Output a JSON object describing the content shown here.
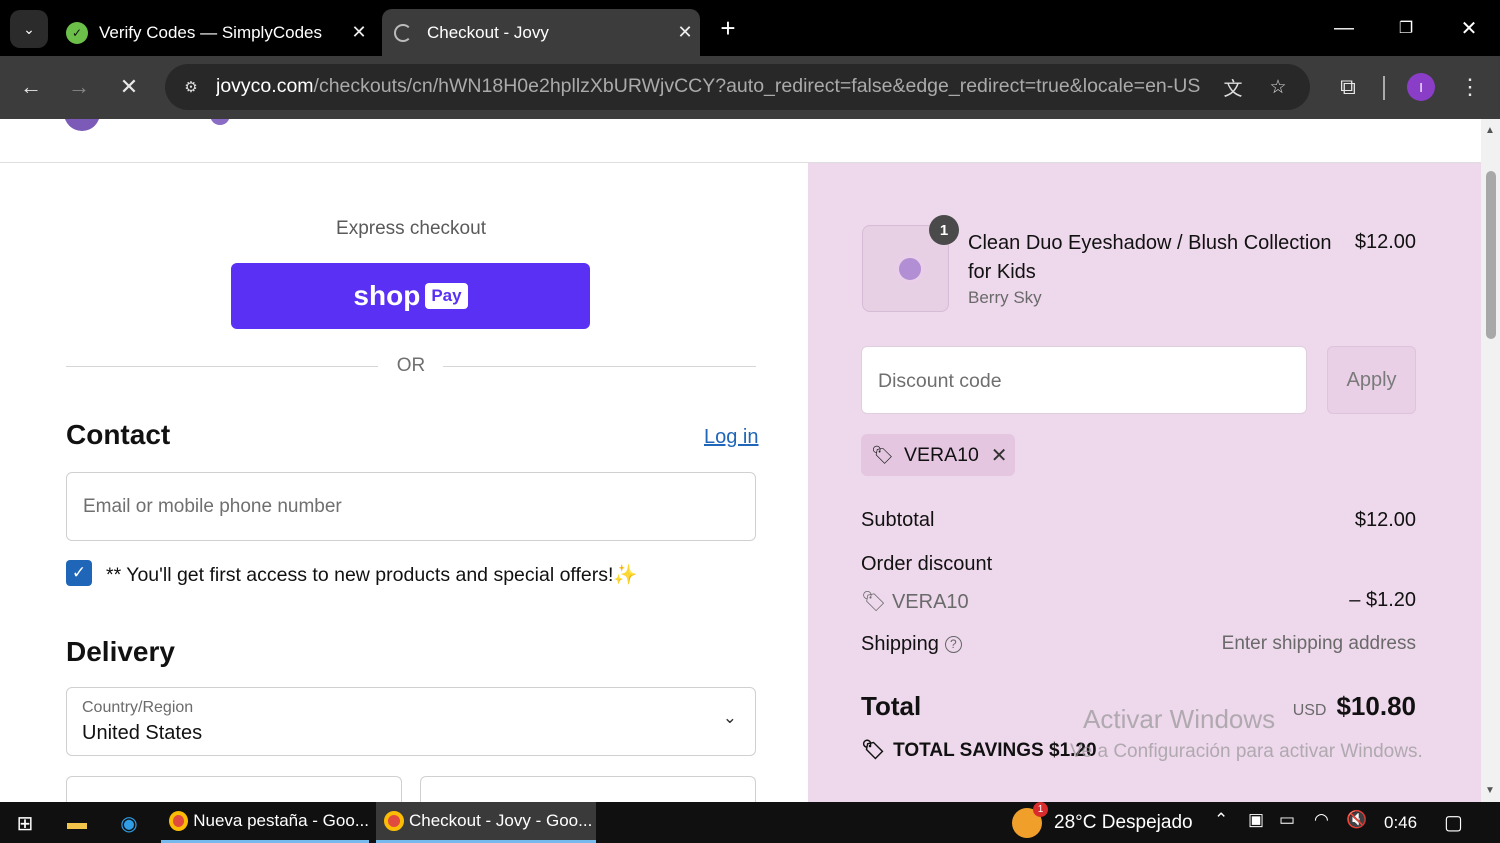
{
  "browser": {
    "tabs": [
      {
        "title": "Verify Codes — SimplyCodes",
        "icon": "simplycodes-icon",
        "active": false
      },
      {
        "title": "Checkout - Jovy",
        "icon": "loading-icon",
        "active": true
      }
    ],
    "url_host": "jovyco.com",
    "url_path": "/checkouts/cn/hWN18H0e2hpllzXbURWjvCCY?auto_redirect=false&edge_redirect=true&locale=en-US...",
    "profile_initial": "I"
  },
  "checkout": {
    "express_label": "Express checkout",
    "shoppay_label": "shop",
    "shoppay_badge": "Pay",
    "or_label": "OR",
    "contact": {
      "heading": "Contact",
      "login_link": "Log in",
      "email_placeholder": "Email or mobile phone number",
      "offers_label": "** You'll get first access to new products and special offers!✨",
      "offers_checked": true
    },
    "delivery": {
      "heading": "Delivery",
      "country_label": "Country/Region",
      "country_value": "United States"
    }
  },
  "summary": {
    "item": {
      "quantity": "1",
      "name": "Clean Duo Eyeshadow / Blush Collection for Kids",
      "variant": "Berry Sky",
      "price": "$12.00"
    },
    "discount_placeholder": "Discount code",
    "apply_label": "Apply",
    "applied_code": "VERA10",
    "subtotal_label": "Subtotal",
    "subtotal_value": "$12.00",
    "order_discount_label": "Order discount",
    "discount_code": "VERA10",
    "discount_value": "– $1.20",
    "shipping_label": "Shipping",
    "shipping_value": "Enter shipping address",
    "total_label": "Total",
    "currency": "USD",
    "total_value": "$10.80",
    "savings_label": "TOTAL SAVINGS",
    "savings_value": "$1.20"
  },
  "watermark": {
    "line1": "Activar Windows",
    "line2": "Ve a Configuración para activar Windows."
  },
  "taskbar": {
    "apps": [
      {
        "label": "Nueva pestaña - Goo...",
        "active": false
      },
      {
        "label": "Checkout - Jovy - Goo...",
        "active": true
      }
    ],
    "weather": "28°C  Despejado",
    "weather_badge": "1",
    "time": "0:46"
  }
}
